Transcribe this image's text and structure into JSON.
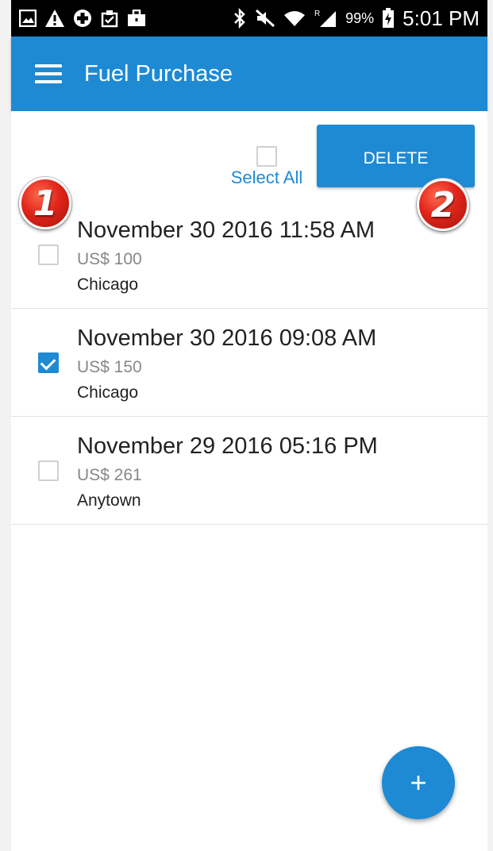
{
  "status_bar": {
    "battery_percent": "99%",
    "time": "5:01 PM",
    "signal_roaming": "R",
    "icons": [
      "image-icon",
      "warning-icon",
      "medical-icon",
      "clipboard-icon",
      "briefcase-icon",
      "bluetooth-icon",
      "mute-icon",
      "wifi-icon",
      "signal-icon",
      "battery-charging-icon"
    ]
  },
  "app_bar": {
    "title": "Fuel Purchase",
    "menu_icon": "hamburger-menu-icon"
  },
  "toolbar": {
    "select_all_label": "Select All",
    "select_all_checked": false,
    "delete_label": "DELETE"
  },
  "purchases": [
    {
      "date": "November 30 2016 11:58 AM",
      "amount": "US$ 100",
      "city": "Chicago",
      "checked": false
    },
    {
      "date": "November 30 2016 09:08 AM",
      "amount": "US$ 150",
      "city": "Chicago",
      "checked": true
    },
    {
      "date": "November 29 2016 05:16 PM",
      "amount": "US$ 261",
      "city": "Anytown",
      "checked": false
    }
  ],
  "callouts": [
    "1",
    "2"
  ],
  "fab": {
    "label": "+"
  },
  "colors": {
    "primary": "#1e8ad4",
    "status_bar": "#000000",
    "callout_red": "#e1251b"
  }
}
